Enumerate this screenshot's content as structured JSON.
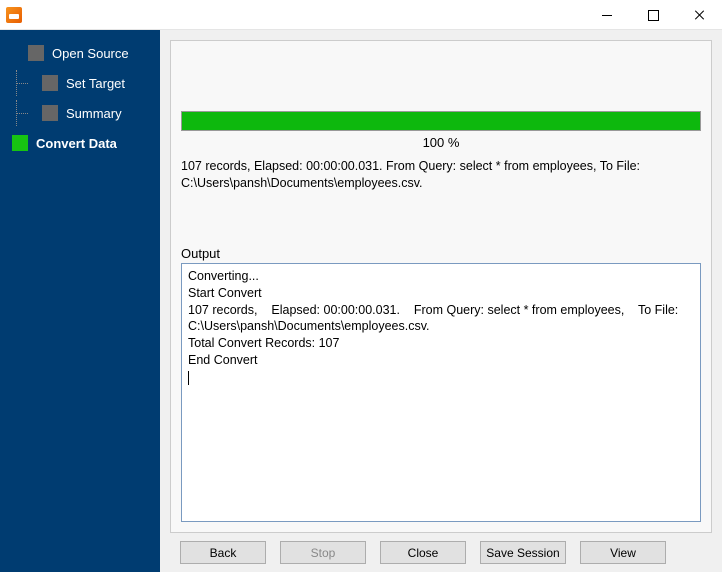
{
  "sidebar": {
    "items": [
      {
        "label": "Open Source"
      },
      {
        "label": "Set Target"
      },
      {
        "label": "Summary"
      },
      {
        "label": "Convert Data"
      }
    ],
    "active_index": 3
  },
  "progress": {
    "percent_label": "100 %"
  },
  "status": {
    "text": "107 records,    Elapsed: 00:00:00.031.    From Query: select * from employees,    To File: C:\\Users\\pansh\\Documents\\employees.csv."
  },
  "output": {
    "label": "Output",
    "lines": [
      "Converting...",
      "Start Convert",
      "107 records,    Elapsed: 00:00:00.031.    From Query: select * from employees,    To File: C:\\Users\\pansh\\Documents\\employees.csv.",
      "Total Convert Records: 107",
      "End Convert"
    ]
  },
  "buttons": {
    "back": "Back",
    "stop": "Stop",
    "close": "Close",
    "save_session": "Save Session",
    "view": "View"
  }
}
